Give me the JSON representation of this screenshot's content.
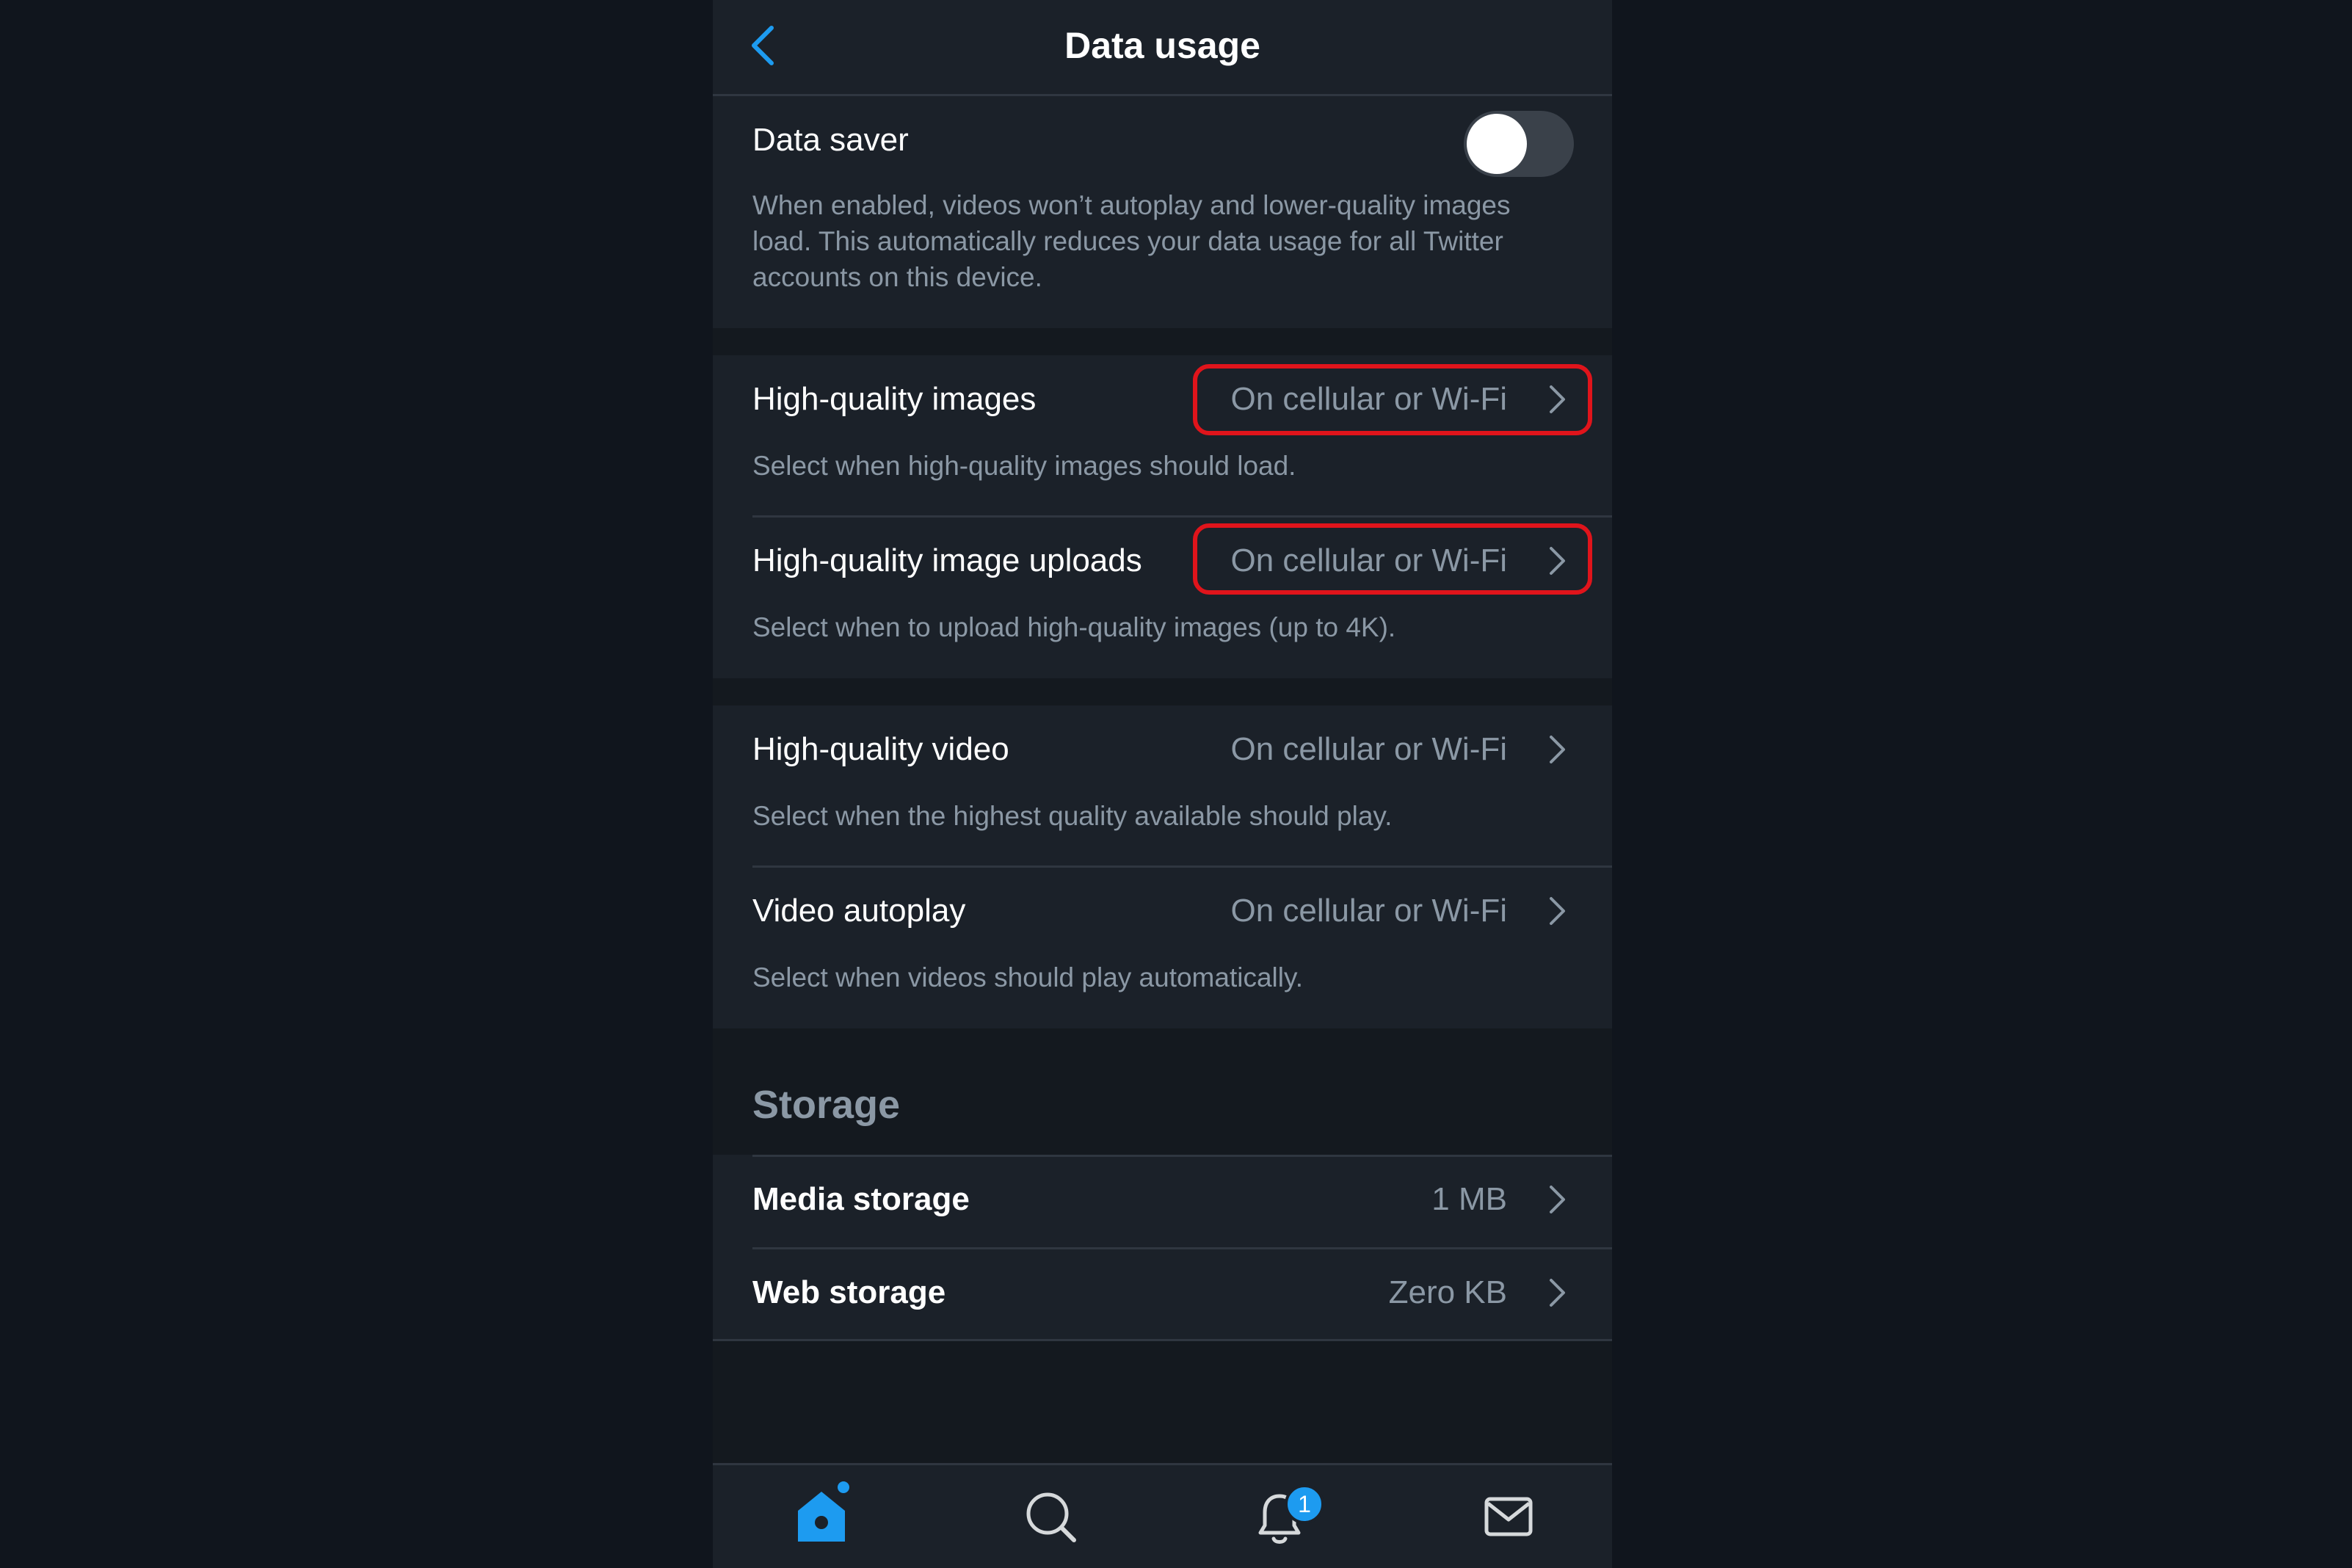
{
  "nav": {
    "title": "Data usage",
    "back_icon": "chevron-left-icon"
  },
  "data_saver": {
    "title": "Data saver",
    "enabled": false,
    "description": "When enabled, videos won’t autoplay and lower-quality images load. This automatically reduces your data usage for all Twitter accounts on this device."
  },
  "image_settings": [
    {
      "title": "High-quality images",
      "value": "On cellular or Wi-Fi",
      "description": "Select when high-quality images should load.",
      "highlighted": true
    },
    {
      "title": "High-quality image uploads",
      "value": "On cellular or Wi-Fi",
      "description": "Select when to upload high-quality images (up to 4K).",
      "highlighted": true
    }
  ],
  "video_settings": [
    {
      "title": "High-quality video",
      "value": "On cellular or Wi-Fi",
      "description": "Select when the highest quality available should play."
    },
    {
      "title": "Video autoplay",
      "value": "On cellular or Wi-Fi",
      "description": "Select when videos should play automatically."
    }
  ],
  "storage": {
    "header": "Storage",
    "items": [
      {
        "title": "Media storage",
        "value": "1 MB"
      },
      {
        "title": "Web storage",
        "value": "Zero KB"
      }
    ]
  },
  "tab_bar": {
    "tabs": [
      {
        "icon": "home-icon",
        "active": true
      },
      {
        "icon": "search-icon",
        "active": false
      },
      {
        "icon": "bell-icon",
        "active": false
      },
      {
        "icon": "mail-icon",
        "active": false
      }
    ],
    "notification_badge": "1"
  },
  "colors": {
    "background": "#10151d",
    "surface": "#1b2129",
    "accent": "#1d9bf0",
    "secondary_text": "#8b98a5",
    "highlight": "#e0141b"
  }
}
